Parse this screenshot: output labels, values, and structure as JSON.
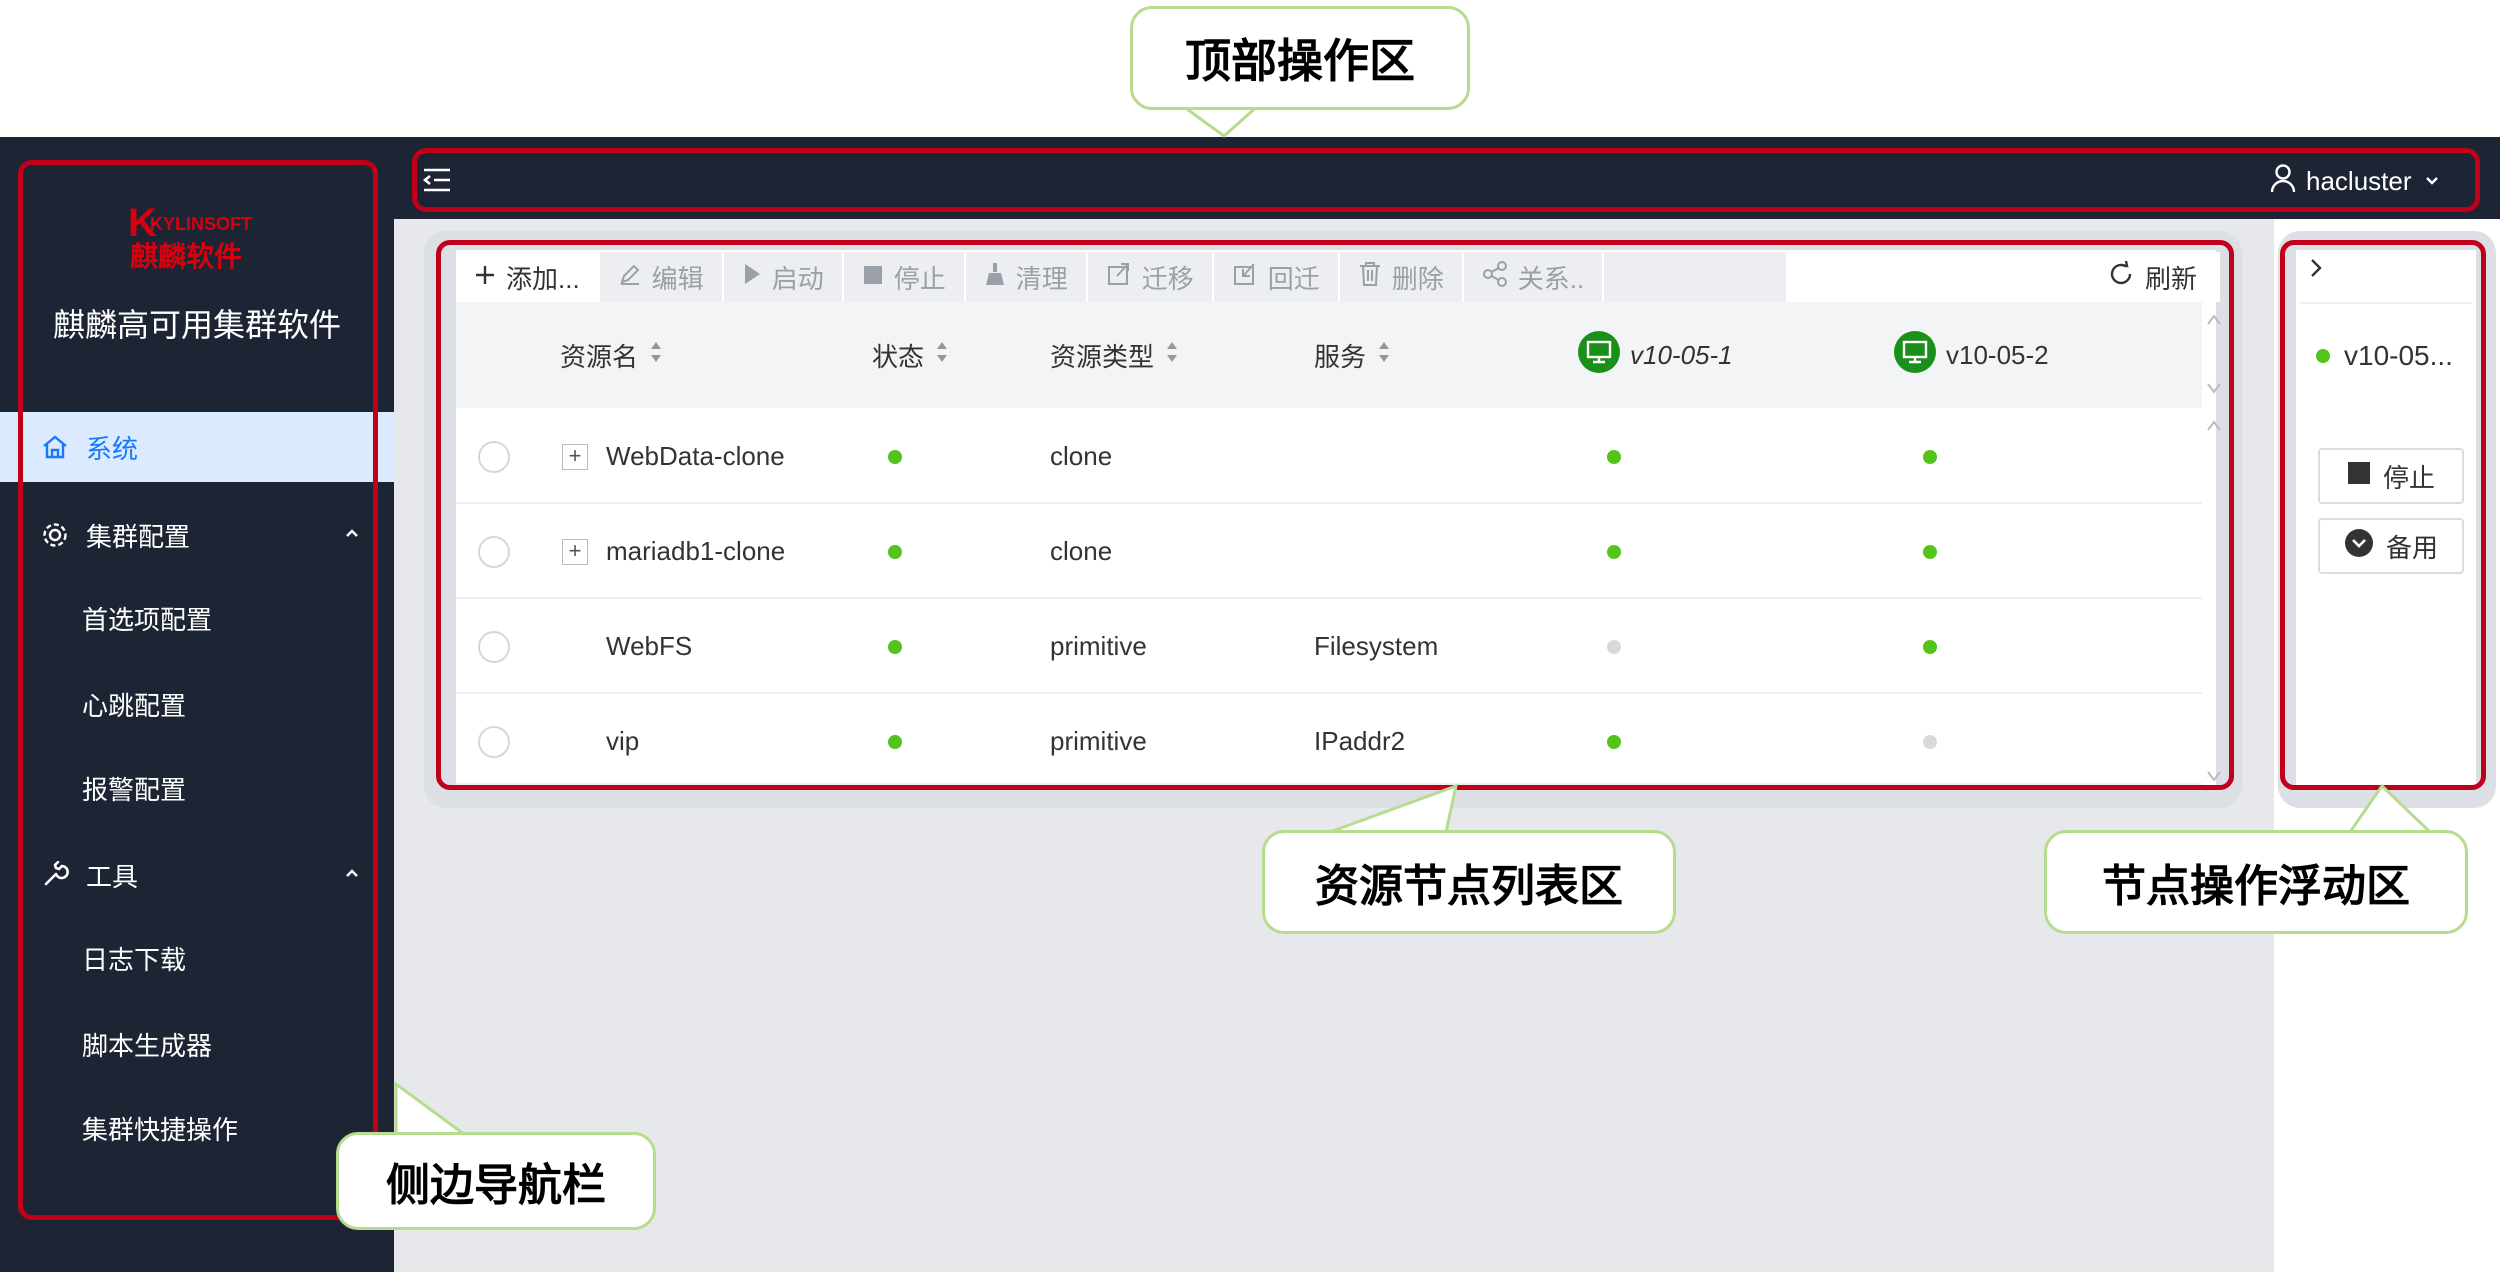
{
  "sidebar": {
    "logo_text_top": "KYLINSOFT",
    "logo_text_bottom": "麒麟软件",
    "app_title": "麒麟高可用集群软件",
    "items": [
      {
        "label": "系统",
        "icon": "home-icon",
        "active": true
      },
      {
        "label": "集群配置",
        "icon": "gear-icon",
        "expanded": true
      },
      {
        "label": "首选项配置"
      },
      {
        "label": "心跳配置"
      },
      {
        "label": "报警配置"
      },
      {
        "label": "工具",
        "icon": "wrench-icon",
        "expanded": true
      },
      {
        "label": "日志下载"
      },
      {
        "label": "脚本生成器"
      },
      {
        "label": "集群快捷操作"
      }
    ]
  },
  "header": {
    "user": "hacluster",
    "menu_icon": "menu-fold-icon",
    "user_icon": "user-icon",
    "caret_icon": "chevron-down-icon"
  },
  "toolbar": {
    "buttons": [
      {
        "label": "添加...",
        "icon": "plus-icon",
        "enabled": true
      },
      {
        "label": "编辑",
        "icon": "pencil-icon",
        "enabled": false
      },
      {
        "label": "启动",
        "icon": "play-icon",
        "enabled": false
      },
      {
        "label": "停止",
        "icon": "stop-icon",
        "enabled": false
      },
      {
        "label": "清理",
        "icon": "broom-icon",
        "enabled": false
      },
      {
        "label": "迁移",
        "icon": "migrate-icon",
        "enabled": false
      },
      {
        "label": "回迁",
        "icon": "return-icon",
        "enabled": false
      },
      {
        "label": "删除",
        "icon": "trash-icon",
        "enabled": false
      },
      {
        "label": "关系..",
        "icon": "share-icon",
        "enabled": false
      }
    ],
    "refresh_label": "刷新"
  },
  "table": {
    "columns": [
      "资源名",
      "状态",
      "资源类型",
      "服务",
      "v10-05-1",
      "v10-05-2"
    ],
    "rows": [
      {
        "name": "WebData-clone",
        "expandable": true,
        "status": "green",
        "type": "clone",
        "service": "",
        "node1": "green",
        "node2": "green"
      },
      {
        "name": "mariadb1-clone",
        "expandable": true,
        "status": "green",
        "type": "clone",
        "service": "",
        "node1": "green",
        "node2": "green"
      },
      {
        "name": "WebFS",
        "expandable": false,
        "status": "green",
        "type": "primitive",
        "service": "Filesystem",
        "node1": "gray",
        "node2": "green"
      },
      {
        "name": "vip",
        "expandable": false,
        "status": "green",
        "type": "primitive",
        "service": "IPaddr2",
        "node1": "green",
        "node2": "gray"
      }
    ]
  },
  "node_panel": {
    "node_name": "v10-05...",
    "stop_label": "停止",
    "standby_label": "备用",
    "collapse_icon": "chevron-right-icon"
  },
  "annotations": {
    "top_area": "顶部操作区",
    "resource_list": "资源节点列表区",
    "node_float": "节点操作浮动区",
    "side_nav": "侧边导航栏"
  },
  "colors": {
    "nav_bg": "#1d2433",
    "active_bg": "#dbeafe",
    "accent": "#1677ff",
    "status_green": "#52c41a",
    "status_gray": "#d9d9d9",
    "node_icon_green": "#1a8f1a",
    "annotation_red": "#c0001a",
    "callout_border": "#b6dc8e",
    "logo_red": "#d7000f"
  }
}
